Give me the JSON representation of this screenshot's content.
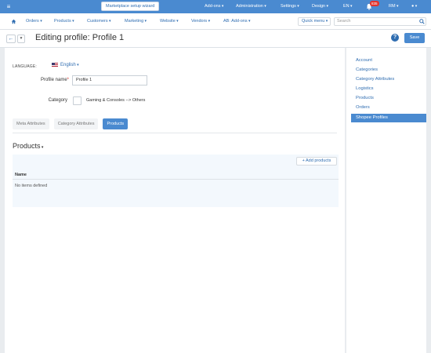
{
  "topbar": {
    "wizard": "Marketplace setup wizard",
    "addons": "Add-ons",
    "administration": "Administration",
    "settings": "Settings",
    "design": "Design",
    "lang": "EN",
    "notifications": "835",
    "user": "RM"
  },
  "nav": {
    "orders": "Orders",
    "products": "Products",
    "customers": "Customers",
    "marketing": "Marketing",
    "website": "Website",
    "vendors": "Vendors",
    "ab_addons": "AB: Add-ons",
    "quick_menu": "Quick menu",
    "search_placeholder": "Search"
  },
  "title": {
    "text": "Editing profile: Profile 1",
    "save": "Save"
  },
  "form": {
    "language_label": "LANGUAGE:",
    "language_value": "English",
    "profile_name_label": "Profile name",
    "profile_name_value": "Profile 1",
    "category_label": "Category",
    "category_value": "Gaming & Consoles --> Others"
  },
  "tabs": [
    "Meta Attributes",
    "Category Attributes",
    "Products"
  ],
  "products": {
    "title": "Products",
    "add_button": "+ Add products",
    "column_name": "Name",
    "empty": "No items defined"
  },
  "sidebar": {
    "items": [
      "Account",
      "Categories",
      "Category Attributes",
      "Logistics",
      "Products",
      "Orders"
    ],
    "active": "Shopee Profiles"
  },
  "colors": {
    "accent": "#4a8ad0",
    "link": "#2f6db1"
  }
}
